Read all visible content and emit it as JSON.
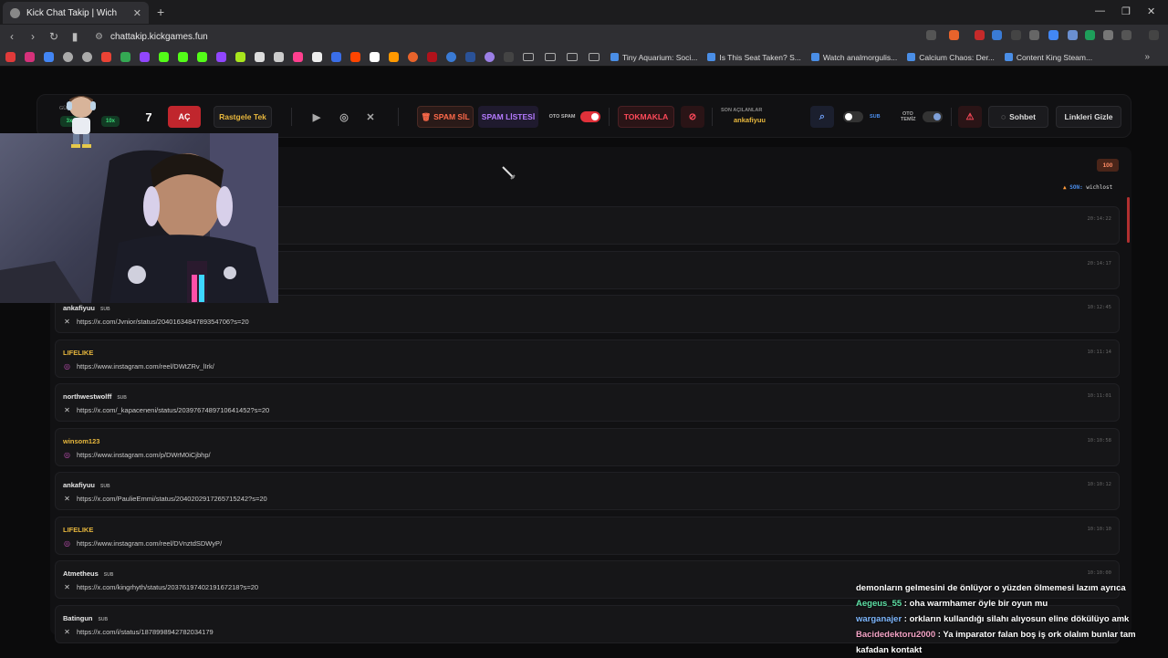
{
  "browser": {
    "tab_title": "Kick Chat Takip | Wich",
    "new_tab": "+",
    "url": "chattakip.kickgames.fun",
    "bookmarks": [
      "Tiny Aquarium: Soci...",
      "Is This Seat Taken? S...",
      "Watch analmorgulis...",
      "Calcium Chaos: Der...",
      "Content King Steam..."
    ]
  },
  "toolbar": {
    "avatar_label": "GÜ",
    "mult_3x": "3x",
    "mult_10x": "10x",
    "count": "7",
    "open_button": "AÇ",
    "random_button": "Rastgele Tek",
    "spam_delete": "SPAM SİL",
    "spam_list": "SPAM LİSTESİ",
    "auto_spam_label": "OTO SPAM",
    "tokmakla": "TOKMAKLA",
    "last_opened_label": "SON AÇILANLAR",
    "last_opened_user": "ankafiyuu",
    "sub_label": "SUB",
    "auto_clean_label_1": "OTO",
    "auto_clean_label_2": "TEMİZ",
    "chat_button": "Sohbet",
    "hide_links_button": "Linkleri Gizle"
  },
  "panel": {
    "count_badge": "100",
    "last_label": "SON:",
    "last_user": "wichlost"
  },
  "cards": [
    {
      "user": "",
      "sub": "",
      "link": "",
      "time": "20:14:22",
      "color": "#e8e8e8",
      "icon": "x"
    },
    {
      "user": "",
      "sub": "",
      "link": "",
      "time": "20:14:17",
      "color": "#e8e8e8",
      "icon": "x"
    },
    {
      "user": "ankafiyuu",
      "sub": "SUB",
      "link": "https://x.com/Jvnior/status/2040163484789354706?s=20",
      "time": "10:12:45",
      "color": "#e8e8e8",
      "icon": "x"
    },
    {
      "user": "LIFELIKE",
      "sub": "",
      "link": "https://www.instagram.com/reel/DWtZRv_lIrk/",
      "time": "10:11:14",
      "color": "#e7b73d",
      "icon": "instagram"
    },
    {
      "user": "northwestwolff",
      "sub": "SUB",
      "link": "https://x.com/_kapaceneni/status/2039767489710641452?s=20",
      "time": "10:11:01",
      "color": "#e8e8e8",
      "icon": "x"
    },
    {
      "user": "winsom123",
      "sub": "",
      "link": "https://www.instagram.com/p/DWrM0iCjbhp/",
      "time": "10:10:58",
      "color": "#e7b73d",
      "icon": "instagram"
    },
    {
      "user": "ankafiyuu",
      "sub": "SUB",
      "link": "https://x.com/PaulieEmmi/status/2040202917265715242?s=20",
      "time": "10:10:12",
      "color": "#e8e8e8",
      "icon": "x"
    },
    {
      "user": "LIFELIKE",
      "sub": "",
      "link": "https://www.instagram.com/reel/DVnztdSDWyP/",
      "time": "10:10:10",
      "color": "#e7b73d",
      "icon": "instagram"
    },
    {
      "user": "Atmetheus",
      "sub": "SUB",
      "link": "https://x.com/kingrhyth/status/2037619740219167218?s=20",
      "time": "10:10:00",
      "color": "#e8e8e8",
      "icon": "x"
    },
    {
      "user": "Batingun",
      "sub": "SUB",
      "link": "https://x.com/i/status/1878998942782034179",
      "time": "",
      "color": "#e8e8e8",
      "icon": "x"
    }
  ],
  "overlay_chat": {
    "line0": "demonların gelmesini de önlüyor o yüzden ölmemesi lazım ayrıca",
    "n1": "Aegeus_55",
    "m1": " : oha warmhamer öyle bir oyun mu",
    "n2": "warganajer",
    "m2": " : orkların kullandığı silahı alıyosun eline dökülüyo amk",
    "n3": "Bacidedektoru2000",
    "m3": " : Ya imparator falan boş iş ork olalım bunlar tam kafadan kontakt"
  },
  "colors": {
    "accent_red": "#e0313a",
    "accent_gold": "#e7b73d",
    "accent_blue": "#4b8ff0",
    "card_bg": "#161618"
  }
}
